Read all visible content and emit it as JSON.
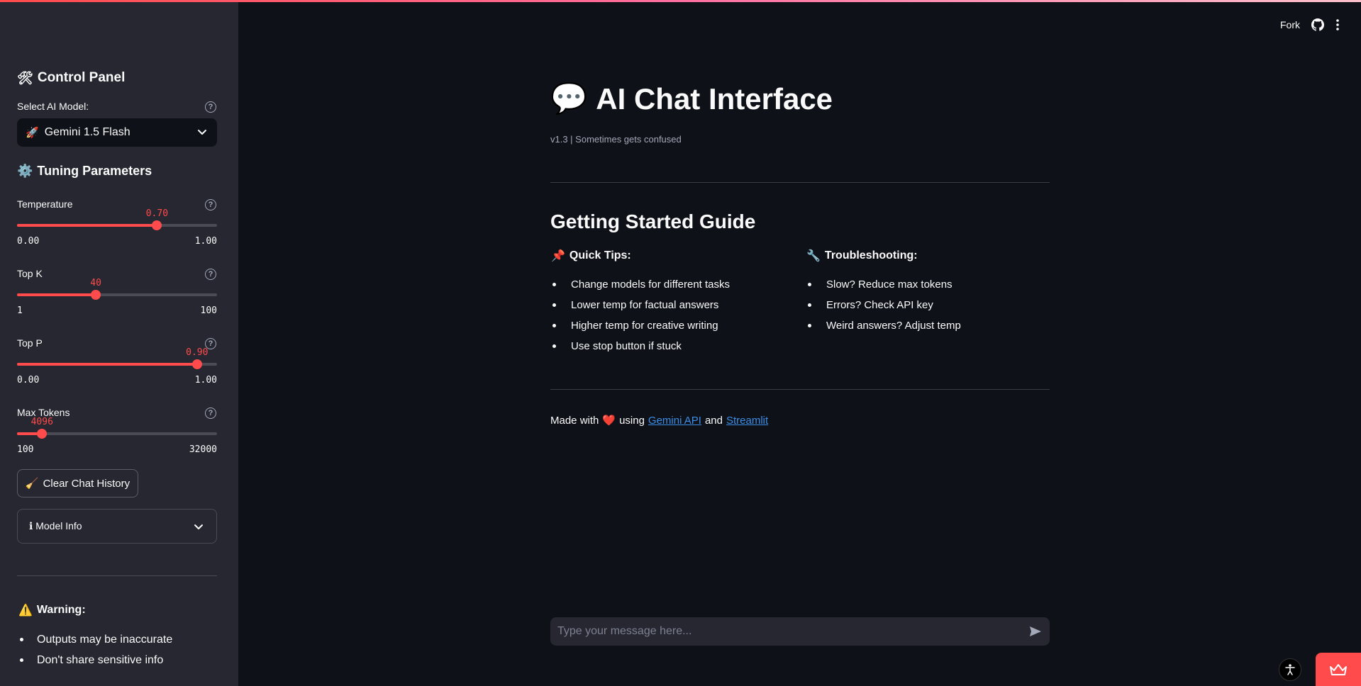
{
  "sidebar": {
    "control_panel": {
      "icon": "tools-icon",
      "title": "Control Panel"
    },
    "model_select": {
      "label": "Select AI Model:",
      "selected": "Gemini 1.5 Flash",
      "selected_icon": "rocket-icon",
      "help": "?"
    },
    "tuning": {
      "icon": "gear-icon",
      "title": "Tuning Parameters"
    },
    "sliders": [
      {
        "name": "Temperature",
        "value": "0.70",
        "min": "0.00",
        "max": "1.00",
        "fraction": 0.7
      },
      {
        "name": "Top K",
        "value": "40",
        "min": "1",
        "max": "100",
        "fraction": 0.394
      },
      {
        "name": "Top P",
        "value": "0.90",
        "min": "0.00",
        "max": "1.00",
        "fraction": 0.9
      },
      {
        "name": "Max Tokens",
        "value": "4096",
        "min": "100",
        "max": "32000",
        "fraction": 0.125
      }
    ],
    "clear_button": {
      "icon": "broom-icon",
      "label": "Clear Chat History"
    },
    "model_info": {
      "label": "ℹ Model Info"
    },
    "warning": {
      "icon": "warning-icon",
      "title": "Warning:",
      "items": [
        "Outputs may be inaccurate",
        "Don't share sensitive info"
      ]
    }
  },
  "header": {
    "fork_label": "Fork"
  },
  "main": {
    "title": "AI Chat Interface",
    "title_icon": "speech-bubble-icon",
    "caption": "v1.3 | Sometimes gets confused",
    "guide_title": "Getting Started Guide",
    "quick_tips": {
      "icon": "pushpin-icon",
      "title": "Quick Tips:",
      "items": [
        "Change models for different tasks",
        "Lower temp for factual answers",
        "Higher temp for creative writing",
        "Use stop button if stuck"
      ]
    },
    "troubleshooting": {
      "icon": "wrench-icon",
      "title": "Troubleshooting:",
      "items": [
        "Slow? Reduce max tokens",
        "Errors? Check API key",
        "Weird answers? Adjust temp"
      ]
    },
    "footer": {
      "made_with": "Made with",
      "using": "using",
      "link1": "Gemini API",
      "and": "and",
      "link2": "Streamlit"
    }
  },
  "chat_input": {
    "placeholder": "Type your message here..."
  },
  "colors": {
    "accent": "#ff4b4b",
    "background": "#0e1117",
    "sidebar": "#262730",
    "link": "#3b8fe8"
  }
}
